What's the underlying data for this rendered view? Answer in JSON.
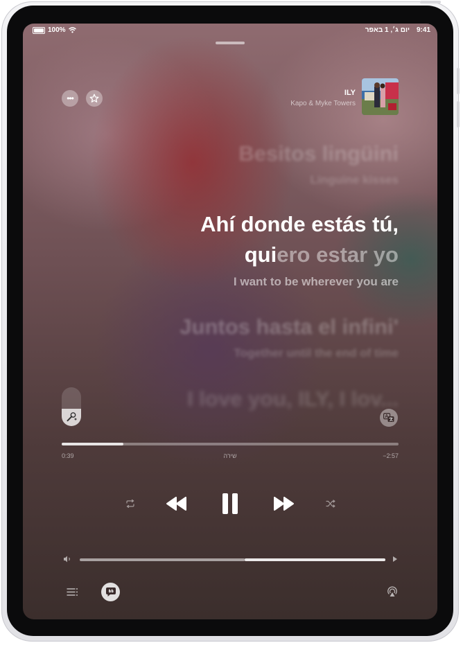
{
  "status_bar": {
    "time": "9:41",
    "date": "יום ג׳, 1 באפר",
    "battery": "100%"
  },
  "now_playing": {
    "title": "ILY",
    "artist": "Kapo & Myke Towers"
  },
  "lyrics": {
    "prev_line": "Besitos lingüini",
    "prev_translation": "Linguine kisses",
    "current_line_1": "Ahí donde estás tú,",
    "current_line_2_sung": "qui",
    "current_line_2_rest": "ero estar yo",
    "current_translation": "I want to be wherever you are",
    "next_line": "Juntos hasta el infini'",
    "next_translation": "Together until the end of time",
    "following_line": "I love you, ILY, I lov..."
  },
  "playback": {
    "elapsed": "0:39",
    "remaining": "−2:57",
    "section_label": "שירה",
    "progress": 0.183,
    "volume": 0.54,
    "vocal_level": 0.45
  },
  "icons": {
    "more": "ellipsis-icon",
    "favorite": "star-icon",
    "karaoke": "microphone-icon",
    "translate": "translate-icon",
    "repeat": "repeat-icon",
    "rewind": "rewind-icon",
    "pause": "pause-icon",
    "forward": "forward-icon",
    "shuffle": "shuffle-icon",
    "vol_low": "volume-low-icon",
    "vol_high": "volume-high-icon",
    "queue": "queue-icon",
    "lyrics": "lyrics-icon",
    "airplay": "airplay-icon"
  }
}
